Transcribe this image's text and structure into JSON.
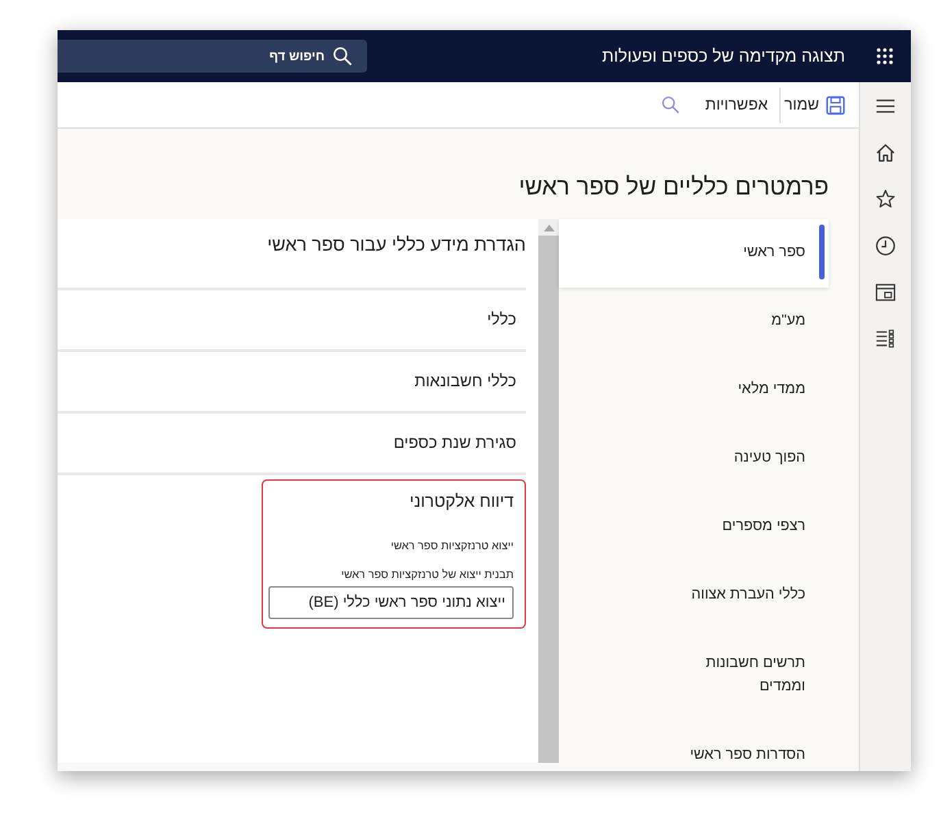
{
  "app_bar": {
    "title": "תצוגה מקדימה של כספים ופעולות",
    "search": {
      "placeholder": "חיפוש דף"
    }
  },
  "toolbar": {
    "save": "שמור",
    "options": "אפשרויות"
  },
  "page": {
    "title": "פרמטרים כלליים של ספר ראשי"
  },
  "tabs": [
    {
      "label": "ספר ראשי",
      "selected": true
    },
    {
      "label": "מע\"מ",
      "selected": false
    },
    {
      "label": "ממדי מלאי",
      "selected": false
    },
    {
      "label": "הפוך טעינה",
      "selected": false
    },
    {
      "label": "רצפי מספרים",
      "selected": false
    },
    {
      "label": "כללי העברת אצווה",
      "selected": false
    },
    {
      "label": "תרשים חשבונות וממדים",
      "selected": false
    },
    {
      "label": "הסדרות ספר ראשי",
      "selected": false
    }
  ],
  "panel": {
    "heading": "הגדרת מידע כללי עבור ספר ראשי",
    "sections": [
      {
        "title": "כללי",
        "highlighted": false
      },
      {
        "title": "כללי חשבונאות",
        "highlighted": false
      },
      {
        "title": "סגירת שנת כספים",
        "highlighted": false
      },
      {
        "title": "דיווח אלקטרוני",
        "highlighted": true,
        "fields": [
          {
            "kind": "label",
            "label": "ייצוא טרנזקציות ספר ראשי"
          },
          {
            "kind": "text",
            "label": "תבנית ייצוא של טרנזקציות ספר ראשי",
            "value": "ייצוא נתוני ספר ראשי כללי (BE)"
          }
        ]
      }
    ]
  }
}
